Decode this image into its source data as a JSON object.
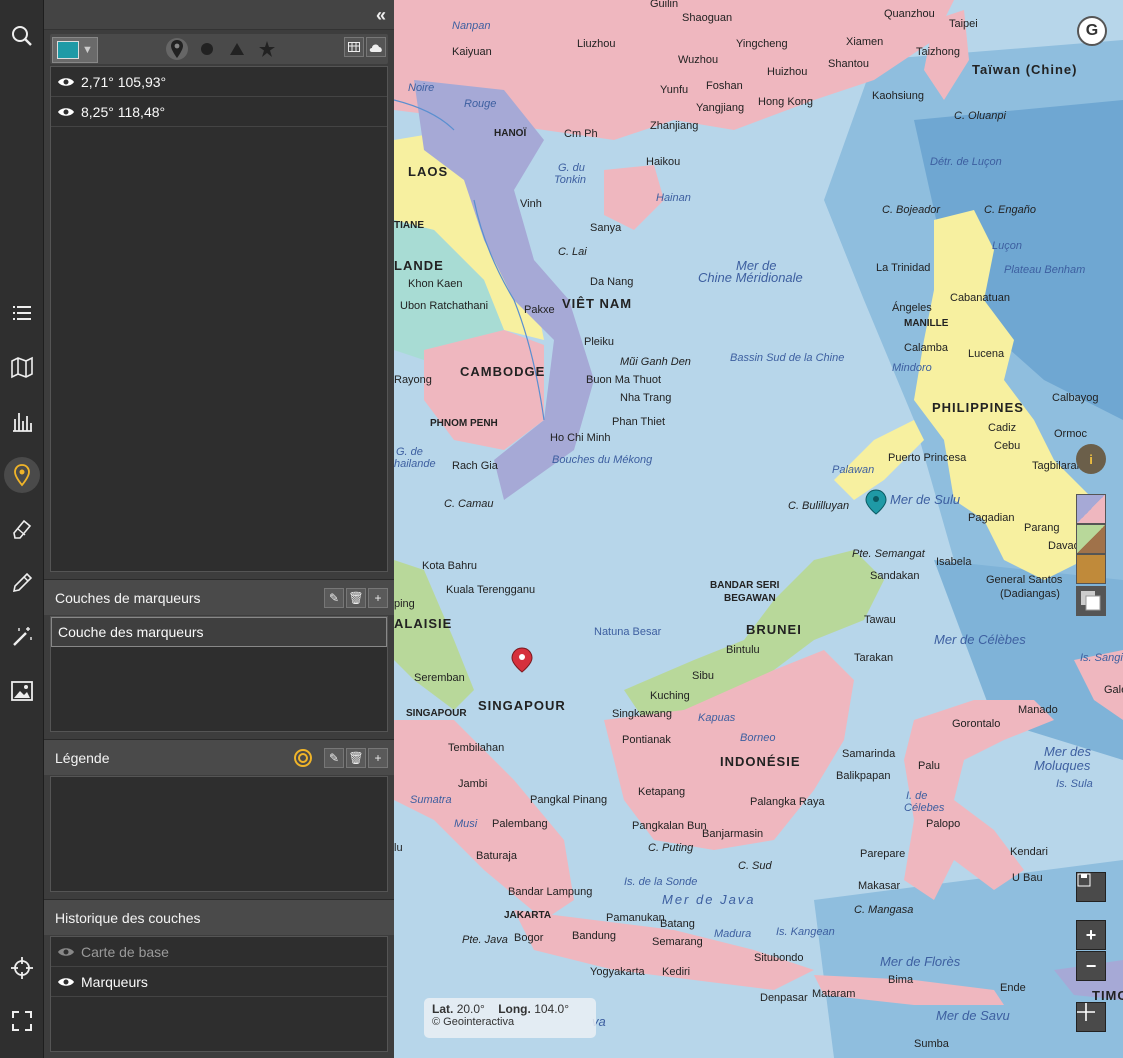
{
  "rail": {
    "icons": [
      "search-icon",
      "list-icon",
      "map-icon",
      "chart-icon",
      "marker-icon",
      "eraser-icon",
      "pencil-icon",
      "magic-wand-icon",
      "image-icon",
      "crosshair-icon",
      "fullscreen-icon"
    ]
  },
  "panel": {
    "markers": [
      {
        "label": "2,71° 105,93°"
      },
      {
        "label": "8,25° 118,48°"
      }
    ],
    "marker_color": "#1f9aa6",
    "layers_section": {
      "title": "Couches de marqueurs",
      "items": [
        {
          "label": "Couche des marqueurs"
        }
      ]
    },
    "legend_section": {
      "title": "Légende"
    },
    "history_section": {
      "title": "Historique des couches",
      "items": [
        {
          "label": "Carte de base"
        },
        {
          "label": "Marqueurs"
        }
      ]
    },
    "btn_add": "+"
  },
  "map": {
    "labels": {
      "guilin": "Guilin",
      "shaoguan": "Shaoguan",
      "quanzhou": "Quanzhou",
      "taipei": "Taipei",
      "kaiyuan": "Kaiyuan",
      "nanpan": "Nanpan",
      "liuzhou": "Liuzhou",
      "yingcheng": "Yingcheng",
      "xiamen": "Xiamen",
      "taizhong": "Taizhong",
      "wuzhou": "Wuzhou",
      "huizhou": "Huizhou",
      "shantou": "Shantou",
      "taiwan": "Taïwan (Chine)",
      "noire": "Noire",
      "yunfu": "Yunfu",
      "foshan": "Foshan",
      "hongkong": "Hong Kong",
      "kaohsiung": "Kaohsiung",
      "rouge": "Rouge",
      "yangjiang": "Yangjiang",
      "olvanpi": "C. Oluanpi",
      "hanoi": "HANOÏ",
      "camph": "Cm Ph",
      "zhanjiang": "Zhanjiang",
      "haikou": "Haikou",
      "detr_lucon": "Détr. de Luçon",
      "gdu": "G. du",
      "tonkin": "Tonkin",
      "laos": "LAOS",
      "hainan": "Hainan",
      "vinh": "Vinh",
      "bojeador": "C. Bojeador",
      "engano": "C. Engaño",
      "tiane": "TIANE",
      "sanya": "Sanya",
      "lucon": "Luçon",
      "clai": "C. Lai",
      "mer_chine": "Mer de",
      "chine_merid": "Chine Méridionale",
      "lande": "LANDE",
      "khonkaen": "Khon Kaen",
      "danang": "Da Nang",
      "latrinidad": "La Trinidad",
      "plateau_benham": "Plateau Benham",
      "ubon": "Ubon Ratchathani",
      "vietnam": "VIÊT NAM",
      "cabanatuan": "Cabanatuan",
      "pakxe": "Pakxe",
      "angeles": "Ángeles",
      "manille": "MANILLE",
      "pleiku": "Pleiku",
      "calamba": "Calamba",
      "lucena": "Lucena",
      "bassin": "Bassin Sud de la Chine",
      "mui": "Mũi Ganh Den",
      "rayong": "Rayong",
      "cambodge": "CAMBODGE",
      "buonma": "Buon Ma Thuot",
      "mindoro": "Mindoro",
      "nhatrang": "Nha Trang",
      "philippines": "PHILIPPINES",
      "calbayog": "Calbayog",
      "phnompenh": "PHNOM PENH",
      "phanthiet": "Phan Thiet",
      "cadiz": "Cadiz",
      "ormoc": "Ormoc",
      "hochiminh": "Ho Chi Minh",
      "puerto": "Puerto Princesa",
      "cebu": "Cebu",
      "gde": "G. de",
      "thailande": "hailande",
      "rachgia": "Rach Gia",
      "bouches": "Bouches du Mékong",
      "tagbilaran": "Tagbilaran",
      "palawan": "Palawan",
      "ccamau": "C. Camau",
      "cbulil": "C. Bulilluyan",
      "merdesulu": "Mer de Sulu",
      "pagadian": "Pagadian",
      "parang": "Parang",
      "davao": "Davao",
      "ptesemangat": "Pte. Semangat",
      "kotabahru": "Kota Bahru",
      "kualatereng": "Kuala Terengganu",
      "sandakan": "Sandakan",
      "isabela": "Isabela",
      "bandarseri": "BANDAR SERI",
      "begawan": "BEGAWAN",
      "gensan": "General Santos",
      "dadiangas": "(Dadiangas)",
      "ping": "ping",
      "naturabesar": "Natuna Besar",
      "brunei": "BRUNEI",
      "tawau": "Tawau",
      "malaisie": "ALAISIE",
      "merdecelebes": "Mer de Célèbes",
      "bintulu": "Bintulu",
      "tarakan": "Tarakan",
      "issangil": "Is. Sangil",
      "seremban": "Seremban",
      "sibu": "Sibu",
      "singapourcap": "SINGAPOUR",
      "singapour": "SINGAPOUR",
      "kuching": "Kuching",
      "manado": "Manado",
      "gale": "Gale",
      "singkawang": "Singkawang",
      "kapuas": "Kapuas",
      "gorontalo": "Gorontalo",
      "tembilahan": "Tembilahan",
      "pontianak": "Pontianak",
      "borneo": "Borneo",
      "samarinda": "Samarinda",
      "merdes": "Mer des",
      "moluques": "Moluques",
      "indonesie": "INDONÉSIE",
      "balikpapan": "Balikpapan",
      "palu": "Palu",
      "jambi": "Jambi",
      "issula": "Is. Sula",
      "sumatra": "Sumatra",
      "pangkal": "Pangkal Pinang",
      "ketapang": "Ketapang",
      "palangka": "Palangka Raya",
      "idecelebes": "I. de",
      "celebes": "Célebes",
      "musi": "Musi",
      "palembang": "Palembang",
      "pangkalanbun": "Pangkalan Bun",
      "banjarmasin": "Banjarmasin",
      "palopo": "Palopo",
      "cputing": "C. Puting",
      "kendari": "Kendari",
      "lu": "lu",
      "baturaja": "Baturaja",
      "parepare": "Parepare",
      "csud": "C. Sud",
      "isdelasonde": "Is. de la Sonde",
      "kubau": "U Bau",
      "merdejava": "Mer de Java",
      "makasar": "Makasar",
      "bandarlampung": "Bandar Lampung",
      "cmangasa": "C. Mangasa",
      "jakarta": "JAKARTA",
      "pamanukan": "Pamanukan",
      "batang": "Batang",
      "madura": "Madura",
      "iskangean": "Is. Kangean",
      "ptejava": "Pte. Java",
      "bogor": "Bogor",
      "bandung": "Bandung",
      "semarang": "Semarang",
      "situbondo": "Situbondo",
      "merdeflores": "Mer de Florès",
      "yogyakarta": "Yogyakarta",
      "kediri": "Kediri",
      "bima": "Bima",
      "ende": "Ende",
      "denpasar": "Denpasar",
      "mataram": "Mataram",
      "timo": "TIMO",
      "merdesavu": "Mer de Savu",
      "sumba": "Sumba",
      "java": "va"
    },
    "coords": {
      "lat_label": "Lat.",
      "lat": "20.0°",
      "lon_label": "Long.",
      "lon": "104.0°",
      "copyright": "© Geointeractiva"
    },
    "zoom_in": "+",
    "zoom_out": "−",
    "info": "i",
    "logo": "G"
  }
}
